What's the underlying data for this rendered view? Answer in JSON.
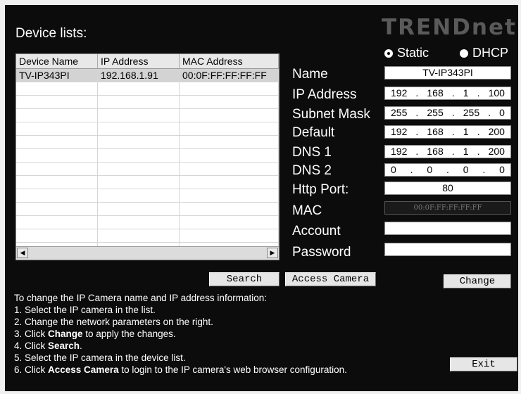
{
  "header": {
    "title": "Device lists:",
    "logo": "TRENDnet"
  },
  "device_table": {
    "columns": [
      "Device Name",
      "IP Address",
      "MAC Address"
    ],
    "rows": [
      [
        "TV-IP343PI",
        "192.168.1.91",
        "00:0F:FF:FF:FF:FF"
      ]
    ],
    "empty_rows": 13
  },
  "mode": {
    "static_label": "Static",
    "dhcp_label": "DHCP",
    "selected": "Static"
  },
  "form": {
    "name_label": "Name",
    "name_value": "TV-IP343PI",
    "ip_label": "IP Address",
    "ip": [
      "192",
      "168",
      "1",
      "100"
    ],
    "subnet_label": "Subnet Mask",
    "subnet": [
      "255",
      "255",
      "255",
      "0"
    ],
    "default_label": "Default",
    "gateway": [
      "192",
      "168",
      "1",
      "200"
    ],
    "dns1_label": "DNS 1",
    "dns1": [
      "192",
      "168",
      "1",
      "200"
    ],
    "dns2_label": "DNS 2",
    "dns2": [
      "0",
      "0",
      "0",
      "0"
    ],
    "http_label": "Http Port:",
    "http_port": "80",
    "mac_label": "MAC",
    "mac_value": "00:0F:FF:FF:FF:FF",
    "account_label": "Account",
    "account_value": "",
    "password_label": "Password",
    "password_value": ""
  },
  "buttons": {
    "search": "Search",
    "access": "Access Camera",
    "change": "Change",
    "exit": "Exit"
  },
  "instructions": {
    "intro": "To change the IP Camera name and IP address information:",
    "s1": "1. Select the IP camera in the list.",
    "s2": "2. Change the network parameters on the right.",
    "s3_pre": "3. Click ",
    "s3_bold": "Change",
    "s3_post": " to apply the changes.",
    "s4_pre": "4. Click ",
    "s4_bold": "Search",
    "s4_post": ".",
    "s5": "5. Select the IP camera in the device list.",
    "s6_pre": "6. Click ",
    "s6_bold": "Access Camera",
    "s6_post": " to login to the IP camera's web browser configuration."
  }
}
